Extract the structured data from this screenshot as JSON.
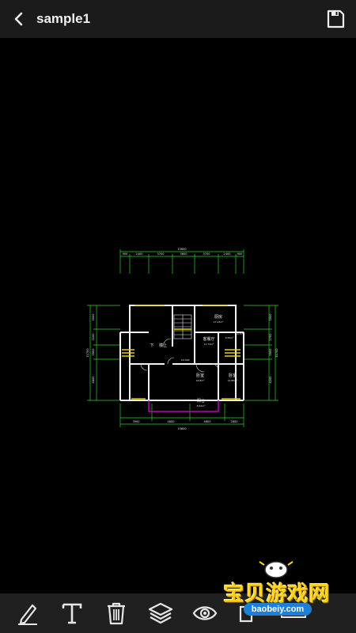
{
  "header": {
    "title": "sample1",
    "back_icon": "chevron-left-icon",
    "save_icon": "floppy-disk-icon"
  },
  "drawing": {
    "overall_top": "15600",
    "overall_bottom": "15600",
    "right_total": "11700",
    "left_total": "11700",
    "top_dims": [
      "900",
      "2400",
      "3700",
      "3600",
      "3700",
      "2400",
      "900"
    ],
    "bottom_dims": [
      "3900",
      "4800",
      "4800",
      "2800"
    ],
    "left_dims": [
      "3000",
      "2100",
      "1800",
      "4800"
    ],
    "right_dims": [
      "3000",
      "2700",
      "1800",
      "4200"
    ],
    "rooms": {
      "kitchen": "厨房",
      "kitchen_area": "17.43m²",
      "stairs_down": "下",
      "stairs_up": "楼上",
      "living": "客餐厅",
      "living_area": "11.72m²",
      "bath": "卫生间",
      "bath_area": "6.50m²",
      "bedroom1": "卧室",
      "bedroom1_area": "16.8m²",
      "bedroom2": "卧室",
      "bedroom2_area": "14.85m²",
      "balcony": "阳台",
      "balcony_area": "8.62m²",
      "elev": "±0.000"
    },
    "colors": {
      "wall": "#f2f2f2",
      "dim": "#2ed12e",
      "accent_yellow": "#e8d000",
      "magenta": "#c000c0"
    }
  },
  "toolbar": {
    "tools": [
      "pencil-icon",
      "text-icon",
      "trash-icon",
      "layers-icon",
      "eye-icon",
      "select-icon",
      "ruler-icon"
    ]
  },
  "watermark": {
    "brand": "宝贝游戏网",
    "url": "baobeiy.com"
  }
}
